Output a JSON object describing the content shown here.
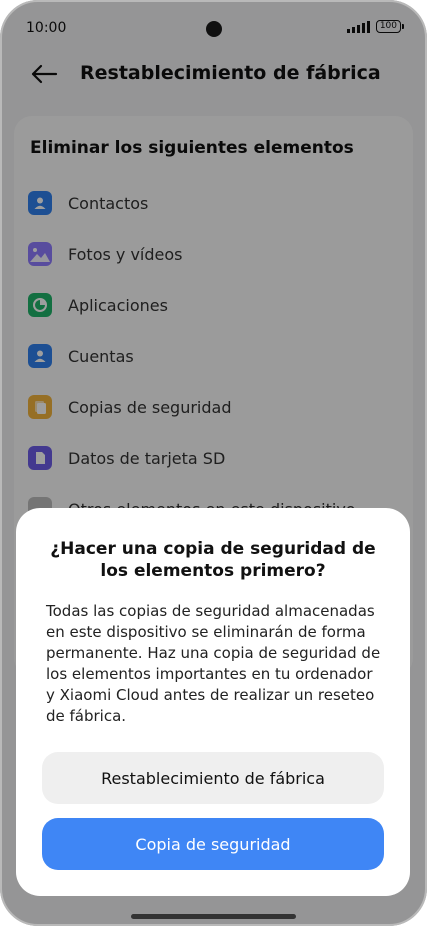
{
  "status_bar": {
    "time": "10:00",
    "battery": "100"
  },
  "app_bar": {
    "title": "Restablecimiento de fábrica"
  },
  "card": {
    "title": "Eliminar los siguientes elementos",
    "items": [
      {
        "label": "Contactos",
        "icon": "contacts-icon",
        "color": "#2f80ed"
      },
      {
        "label": "Fotos y vídeos",
        "icon": "gallery-icon",
        "color": "#7b61ff"
      },
      {
        "label": "Aplicaciones",
        "icon": "apps-icon",
        "color": "#1fb36a"
      },
      {
        "label": "Cuentas",
        "icon": "accounts-icon",
        "color": "#2f80ed"
      },
      {
        "label": "Copias de seguridad",
        "icon": "backup-icon",
        "color": "#f2b43d"
      },
      {
        "label": "Datos de tarjeta SD",
        "icon": "sd-card-icon",
        "color": "#6c5ce7"
      },
      {
        "label": "Otros elementos en este dispositivo",
        "icon": "other-items-icon",
        "color": "#bdbdbd"
      }
    ]
  },
  "dialog": {
    "title": "¿Hacer una copia de seguridad de los elementos primero?",
    "body": "Todas las copias de seguridad almacenadas en este dispositivo se eliminarán de forma permanente. Haz una copia de seguridad de los elementos importantes en tu ordenador y Xiaomi Cloud antes de realizar un reseteo de fábrica.",
    "buttons": {
      "factory_reset": "Restablecimiento de fábrica",
      "backup": "Copia de seguridad"
    }
  },
  "colors": {
    "primary_button": "#3f86f5",
    "scrim": "rgba(0,0,0,0.38)"
  }
}
